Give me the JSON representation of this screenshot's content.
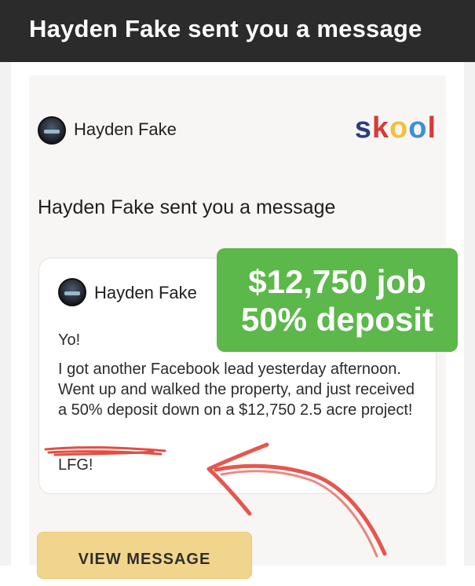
{
  "notification": {
    "title": "Hayden Fake sent you a message"
  },
  "email": {
    "sender_name": "Hayden Fake",
    "brand": {
      "letters": [
        "s",
        "k",
        "o",
        "o",
        "l"
      ],
      "letter_colors": [
        "#2e3d7c",
        "#d63b39",
        "#f4c03e",
        "#3d8fd6",
        "#d63b39"
      ]
    },
    "headline": "Hayden Fake sent you a message",
    "message": {
      "author": "Hayden Fake",
      "greeting": "Yo!",
      "body": "I got another Facebook lead yesterday afternoon. Went up and walked the property, and just received a 50% deposit down on a $12,750 2.5 acre project!",
      "signoff": "LFG!"
    },
    "button_label": "VIEW MESSAGE"
  },
  "overlay": {
    "badge_line1": "$12,750 job",
    "badge_line2": "50% deposit",
    "badge_color": "#5cb84a",
    "annotation_color": "#e03a2f"
  }
}
